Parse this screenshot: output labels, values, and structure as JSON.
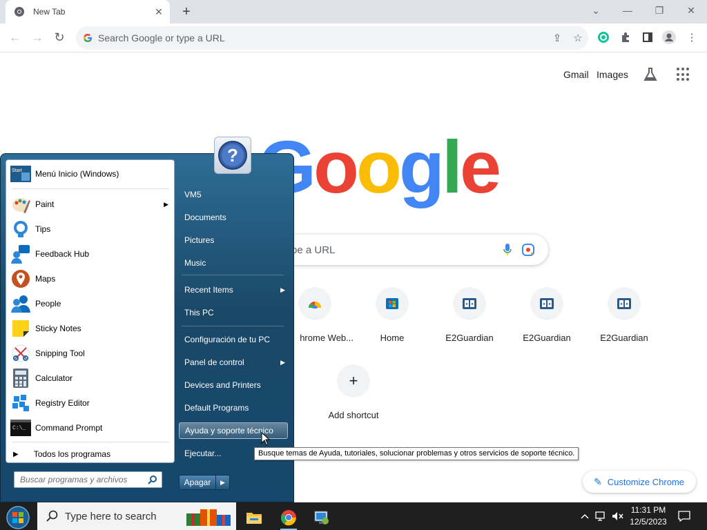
{
  "browser": {
    "tab_title": "New Tab",
    "omnibox_placeholder": "Search Google or type a URL"
  },
  "ntp": {
    "links": [
      "Gmail",
      "Images"
    ],
    "logo_letters": [
      "G",
      "o",
      "o",
      "g",
      "l",
      "e"
    ],
    "logo_colors": [
      "#4285f4",
      "#ea4335",
      "#fbbc05",
      "#4285f4",
      "#34a853",
      "#ea4335"
    ],
    "search_placeholder_visible": "pe a URL",
    "shortcuts": [
      {
        "label": "hrome Web...",
        "icon": "chrome-web-store-icon"
      },
      {
        "label": "Home",
        "icon": "microsoft-store-icon"
      },
      {
        "label": "E2Guardian",
        "icon": "cards-icon"
      },
      {
        "label": "E2Guardian",
        "icon": "cards-icon"
      },
      {
        "label": "E2Guardian",
        "icon": "cards-icon"
      }
    ],
    "add_shortcut": "Add shortcut",
    "customize": "Customize Chrome"
  },
  "start_menu": {
    "pinned": "Menú Inicio (Windows)",
    "programs": [
      {
        "label": "Paint",
        "icon": "paint-icon",
        "submenu": true
      },
      {
        "label": "Tips",
        "icon": "tips-icon",
        "submenu": false
      },
      {
        "label": "Feedback Hub",
        "icon": "feedback-hub-icon",
        "submenu": false
      },
      {
        "label": "Maps",
        "icon": "maps-icon",
        "submenu": false
      },
      {
        "label": "People",
        "icon": "people-icon",
        "submenu": false
      },
      {
        "label": "Sticky Notes",
        "icon": "sticky-notes-icon",
        "submenu": false
      },
      {
        "label": "Snipping Tool",
        "icon": "snipping-tool-icon",
        "submenu": false
      },
      {
        "label": "Calculator",
        "icon": "calculator-icon",
        "submenu": false
      },
      {
        "label": "Registry Editor",
        "icon": "registry-editor-icon",
        "submenu": false
      },
      {
        "label": "Command Prompt",
        "icon": "command-prompt-icon",
        "submenu": false
      }
    ],
    "all_programs": "Todos los programas",
    "search_placeholder": "Buscar programas y archivos",
    "right_items": [
      {
        "label": "VM5",
        "submenu": false
      },
      {
        "label": "Documents",
        "submenu": false
      },
      {
        "label": "Pictures",
        "submenu": false
      },
      {
        "label": "Music",
        "submenu": false
      },
      {
        "label": "Recent Items",
        "submenu": true
      },
      {
        "label": "This PC",
        "submenu": false
      },
      {
        "label": "Configuración de tu PC",
        "submenu": false
      },
      {
        "label": "Panel de control",
        "submenu": true
      },
      {
        "label": "Devices and Printers",
        "submenu": false
      },
      {
        "label": "Default Programs",
        "submenu": false
      },
      {
        "label": "Ayuda y soporte técnico",
        "submenu": false,
        "highlighted": true
      },
      {
        "label": "Ejecutar...",
        "submenu": false
      }
    ],
    "shutdown": "Apagar",
    "tooltip": "Busque temas de Ayuda, tutoriales, solucionar problemas y otros servicios de soporte técnico."
  },
  "taskbar": {
    "search_placeholder": "Type here to search",
    "time": "11:31 PM",
    "date": "12/5/2023"
  }
}
